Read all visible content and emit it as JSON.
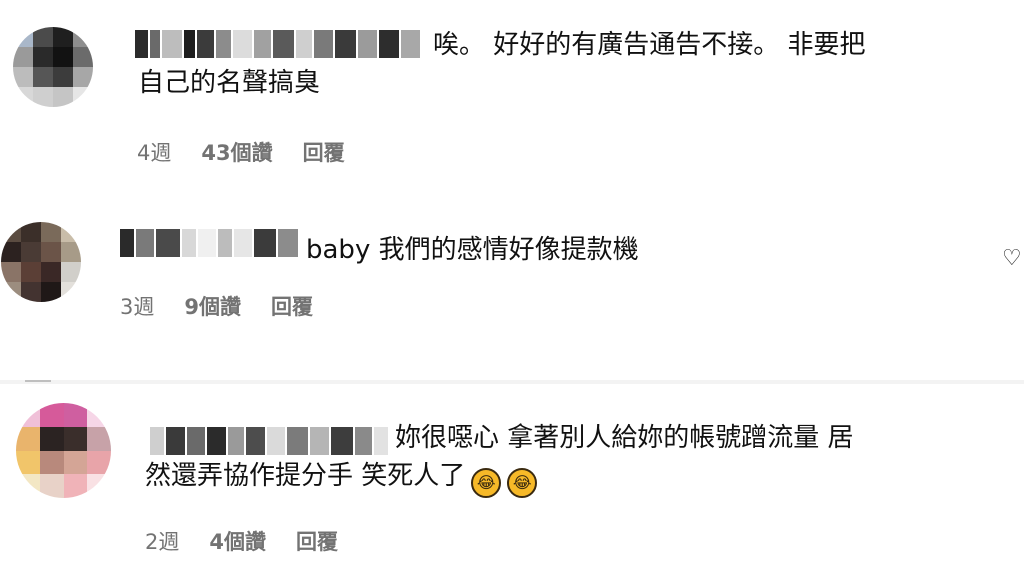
{
  "comments": [
    {
      "text": "唉。 好好的有廣告通告不接。 非要把\n自己的名聲搞臭",
      "age": "4週",
      "likes": "43個讚",
      "reply": "回覆"
    },
    {
      "text": "baby 我們的感情好像提款機",
      "age": "3週",
      "likes": "9個讚",
      "reply": "回覆"
    },
    {
      "text": "妳很噁心 拿著別人給妳的帳號蹭流量 居\n然還弄協作提分手 笑死人了",
      "age": "2週",
      "likes": "4個讚",
      "reply": "回覆"
    }
  ],
  "icons": {
    "heart": "heart-icon",
    "emoji": "rolling-on-floor-laughing-emoji"
  }
}
